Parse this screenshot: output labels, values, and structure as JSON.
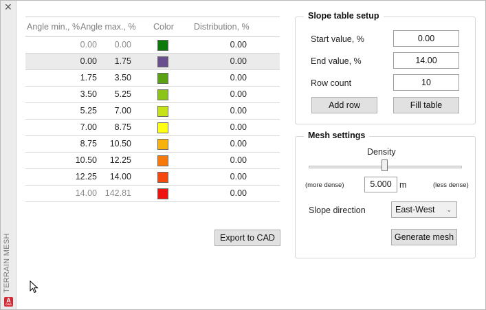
{
  "window": {
    "close_glyph": "✕",
    "side_title": "TERRAIN MESH",
    "logo_letter": "A",
    "logo_small": "CAD"
  },
  "table": {
    "columns": [
      "Angle min., %",
      "Angle max., %",
      "Color",
      "Distribution, %"
    ],
    "rows": [
      {
        "min": "0.00",
        "max": "0.00",
        "color": "#0b7a0b",
        "dist": "0.00"
      },
      {
        "min": "0.00",
        "max": "1.75",
        "color": "#6a4f8e",
        "dist": "0.00"
      },
      {
        "min": "1.75",
        "max": "3.50",
        "color": "#5aa214",
        "dist": "0.00"
      },
      {
        "min": "3.50",
        "max": "5.25",
        "color": "#8cc41a",
        "dist": "0.00"
      },
      {
        "min": "5.25",
        "max": "7.00",
        "color": "#c7e217",
        "dist": "0.00"
      },
      {
        "min": "7.00",
        "max": "8.75",
        "color": "#ffff14",
        "dist": "0.00"
      },
      {
        "min": "8.75",
        "max": "10.50",
        "color": "#f7b30c",
        "dist": "0.00"
      },
      {
        "min": "10.50",
        "max": "12.25",
        "color": "#f7790a",
        "dist": "0.00"
      },
      {
        "min": "12.25",
        "max": "14.00",
        "color": "#f5480f",
        "dist": "0.00"
      },
      {
        "min": "14.00",
        "max": "142.81",
        "color": "#f01111",
        "dist": "0.00"
      }
    ],
    "export_button": "Export to CAD"
  },
  "slope_setup": {
    "title": "Slope table setup",
    "start_label": "Start value, %",
    "start_value": "0.00",
    "end_label": "End value, %",
    "end_value": "14.00",
    "rows_label": "Row count",
    "rows_value": "10",
    "add_row_button": "Add row",
    "fill_table_button": "Fill table"
  },
  "mesh": {
    "title": "Mesh settings",
    "density_label": "Density",
    "density_fraction": 0.5,
    "more_dense": "(more dense)",
    "less_dense": "(less dense)",
    "density_value": "5.000",
    "density_unit": "m",
    "direction_label": "Slope direction",
    "direction_value": "East-West",
    "generate_button": "Generate mesh"
  }
}
